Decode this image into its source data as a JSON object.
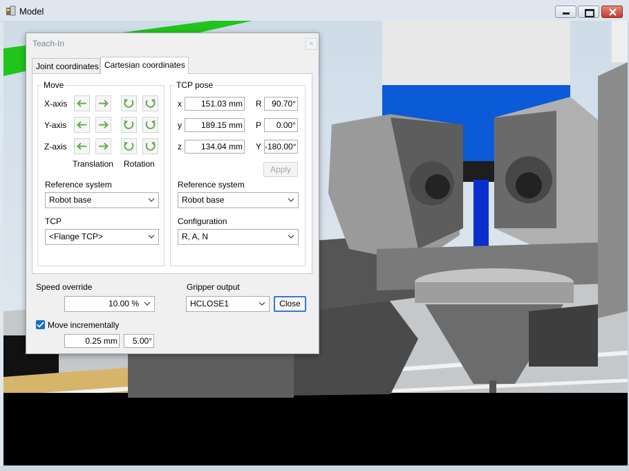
{
  "window": {
    "title": "Model",
    "icon": "model-app-icon"
  },
  "window_controls": [
    "minimize-icon",
    "maximize-icon",
    "close-icon"
  ],
  "colors": {
    "arrow_green": "#6aa84f",
    "selection_blue": "#1a6fc4",
    "robot_blue": "#0b5ad8",
    "floor_black": "#000000"
  },
  "dialog": {
    "title": "Teach-In",
    "close_glyph": "×",
    "tabs": [
      {
        "label": "Joint coordinates",
        "active": false
      },
      {
        "label": "Cartesian coordinates",
        "active": true
      }
    ],
    "move": {
      "title": "Move",
      "axes": [
        "X-axis",
        "Y-axis",
        "Z-axis"
      ],
      "icons": [
        "arrow-left-icon",
        "arrow-right-icon",
        "rotate-ccw-icon",
        "rotate-cw-icon"
      ],
      "translation_label": "Translation",
      "rotation_label": "Rotation",
      "reference_label": "Reference system",
      "reference_value": "Robot base",
      "tcp_label": "TCP",
      "tcp_value": "<Flange TCP>"
    },
    "tcp_pose": {
      "title": "TCP pose",
      "x_label": "x",
      "x_value": "151.03 mm",
      "y_label": "y",
      "y_value": "189.15 mm",
      "z_label": "z",
      "z_value": "134.04 mm",
      "r_label": "R",
      "r_value": "90.70°",
      "p_label": "P",
      "p_value": "0.00°",
      "yaw_label": "Y",
      "yaw_value": "-180.00°",
      "apply_label": "Apply",
      "reference_label": "Reference system",
      "reference_value": "Robot base",
      "configuration_label": "Configuration",
      "configuration_value": "R, A, N"
    },
    "speed_override": {
      "label": "Speed override",
      "value": "10.00 %"
    },
    "gripper_output": {
      "label": "Gripper output",
      "value": "HCLOSE1",
      "button_label": "Close"
    },
    "move_incrementally": {
      "label": "Move incrementally",
      "checked": true,
      "distance": "0.25 mm",
      "angle": "5.00°"
    }
  }
}
